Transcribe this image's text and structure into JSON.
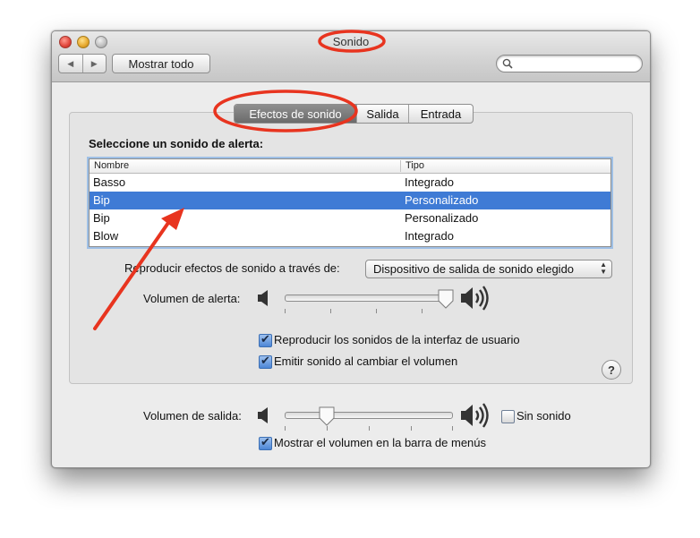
{
  "window": {
    "title": "Sonido",
    "show_all_label": "Mostrar todo",
    "search_placeholder": ""
  },
  "tabs": [
    {
      "label": "Efectos de sonido",
      "active": true
    },
    {
      "label": "Salida",
      "active": false
    },
    {
      "label": "Entrada",
      "active": false
    }
  ],
  "alert_sounds": {
    "heading": "Seleccione un sonido de alerta:",
    "columns": {
      "name": "Nombre",
      "type": "Tipo"
    },
    "rows": [
      {
        "name": "Basso",
        "type": "Integrado",
        "selected": false
      },
      {
        "name": "Bip",
        "type": "Personalizado",
        "selected": true
      },
      {
        "name": "Bip",
        "type": "Personalizado",
        "selected": false
      },
      {
        "name": "Blow",
        "type": "Integrado",
        "selected": false
      }
    ]
  },
  "play_through": {
    "label": "Reproducir efectos de sonido a través de:",
    "selected_option": "Dispositivo de salida de sonido elegido"
  },
  "alert_volume": {
    "label": "Volumen de alerta:",
    "level": 1.0
  },
  "options": {
    "ui_sounds": {
      "label": "Reproducir los sonidos de la interfaz de usuario",
      "checked": true
    },
    "volume_feedback": {
      "label": "Emitir sonido al cambiar el volumen",
      "checked": true
    }
  },
  "help_label": "?",
  "output_volume": {
    "label": "Volumen de salida:",
    "level": 0.25,
    "mute_label": "Sin sonido",
    "mute_checked": false
  },
  "menu_bar_volume": {
    "label": "Mostrar el volumen en la barra de menús",
    "checked": true
  },
  "colors": {
    "selection": "#3f7bd5",
    "annotation": "#e8341f"
  },
  "icons": {
    "close": "close-icon",
    "minimize": "minimize-icon",
    "zoom": "zoom-icon",
    "back": "back-arrow-icon",
    "forward": "forward-arrow-icon",
    "search": "search-icon",
    "speaker_low": "speaker-low-icon",
    "speaker_high": "speaker-high-icon",
    "help": "help-icon"
  }
}
